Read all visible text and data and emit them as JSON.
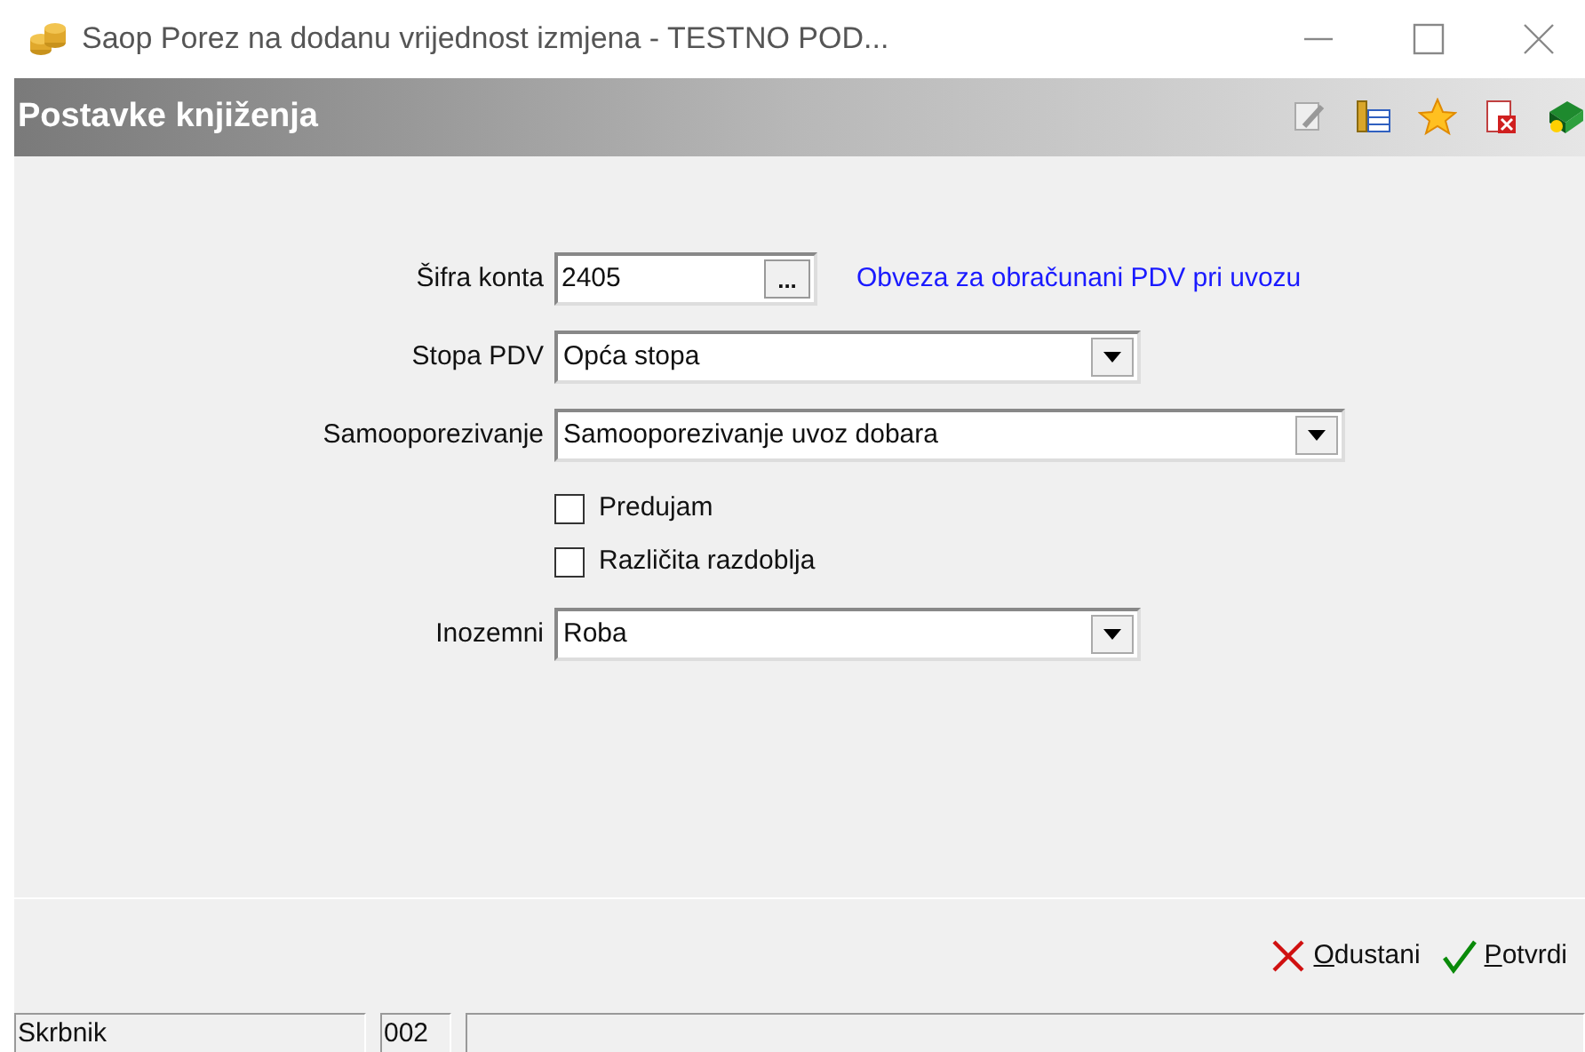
{
  "window": {
    "title": "Saop Porez na dodanu vrijednost izmjena  - TESTNO POD..."
  },
  "header": {
    "title": "Postavke knjiženja",
    "tools": [
      {
        "kind": "edit"
      },
      {
        "kind": "columns"
      },
      {
        "kind": "favorite"
      },
      {
        "kind": "delete"
      },
      {
        "kind": "help"
      }
    ]
  },
  "form": {
    "fields": [
      {
        "kind": "lookup",
        "label": "Šifra konta",
        "value": "2405",
        "button": "...",
        "description": "Obveza za obračunani PDV pri uvozu"
      },
      {
        "kind": "combo",
        "label": "Stopa PDV",
        "value": "Opća stopa"
      },
      {
        "kind": "combo",
        "label": "Samooporezivanje",
        "value": "Samooporezivanje uvoz dobara"
      },
      {
        "kind": "checkbox",
        "label": "Predujam",
        "checked": false
      },
      {
        "kind": "checkbox",
        "label": "Različita razdoblja",
        "checked": false
      },
      {
        "kind": "combo",
        "label": "Inozemni",
        "value": "Roba"
      }
    ]
  },
  "buttons": [
    {
      "kind": "cancel",
      "label": "Odustani"
    },
    {
      "kind": "confirm",
      "label": "Potvrdi"
    }
  ],
  "status_bar": [
    "Skrbnik",
    "002"
  ]
}
